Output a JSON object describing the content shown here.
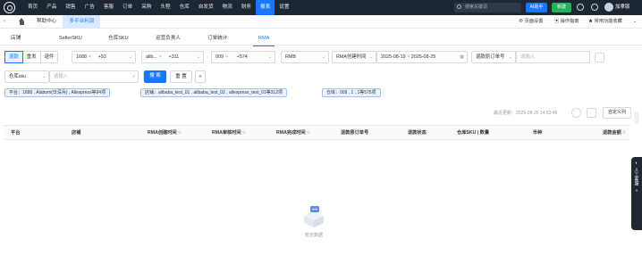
{
  "topnav": {
    "items": [
      "首页",
      "产品",
      "销售",
      "广告",
      "客服",
      "订单",
      "采购",
      "头程",
      "仓库",
      "自发货",
      "物流",
      "财务",
      "报表",
      "设置"
    ],
    "active_index": 12,
    "search_placeholder": "搜索关键词",
    "ai_button": "AI助手",
    "new_button": "新建",
    "user_name": "加拿版"
  },
  "tabbar": {
    "tabs": [
      "帮助中心",
      "多平台利润"
    ],
    "active_index": 1,
    "right_links": [
      "页面设置",
      "操作指南",
      "常用功能收藏"
    ]
  },
  "subtabs": {
    "items": [
      "店铺",
      "SellerSKU",
      "仓库SKU",
      "运营负责人",
      "订单统计",
      "RMA"
    ],
    "active_index": 5
  },
  "filters": {
    "segment": [
      "退款",
      "重发",
      "退件"
    ],
    "segment_active": 0,
    "platform": {
      "value": "1688",
      "more": "+93"
    },
    "shop": {
      "value": "alib...",
      "more": "+311"
    },
    "warehouse": {
      "value": "009",
      "more": "+574"
    },
    "currency": "RMB",
    "date_type": "RMA创建时间",
    "date_start": "2025-08-19",
    "date_sep": "~",
    "date_end": "2025-08-25",
    "order_type": "退款原订单号",
    "order_placeholder": "请输入",
    "sku_type": "仓库sku",
    "sku_placeholder": "请输入",
    "search_button": "搜 索",
    "reset_button": "重 置",
    "add_button": "+"
  },
  "chips": [
    "平台：1688 , Alabom(日深兵) , Allexpress等94项",
    "店铺：alibaba_test_01 , alibaba_test_02 , allexpress_test_01等312项",
    "仓库：009 , 1 , 1等575项"
  ],
  "toolbar": {
    "updated_text": "最近更新：2025-08-26 14:53:46",
    "custom_columns": "自定义列"
  },
  "table": {
    "columns": [
      "平台",
      "店铺",
      "RMA创建时间",
      "RMA审核时间",
      "RMA完成时间",
      "退款原订单号",
      "退款状态",
      "仓库SKU | 数量",
      "币种",
      "退款金额"
    ],
    "sortable": [
      false,
      false,
      true,
      true,
      true,
      false,
      false,
      false,
      false,
      true
    ],
    "empty_text": "暂无数据"
  },
  "float_panel": {
    "label": "人工客服"
  }
}
